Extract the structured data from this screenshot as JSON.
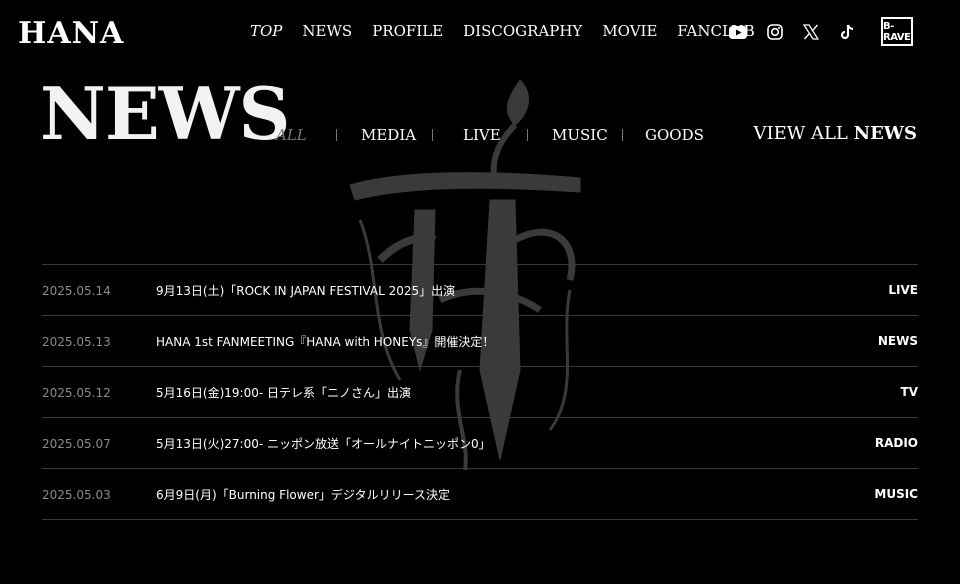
{
  "header": {
    "logo": "HANA",
    "nav": [
      {
        "label": "TOP",
        "active": true
      },
      {
        "label": "NEWS"
      },
      {
        "label": "PROFILE"
      },
      {
        "label": "DISCOGRAPHY"
      },
      {
        "label": "MOVIE"
      },
      {
        "label": "FANCLUB"
      }
    ],
    "social": [
      "youtube-icon",
      "instagram-icon",
      "x-icon",
      "tiktok-icon"
    ],
    "brand_badge": "B-RAVE"
  },
  "section": {
    "title": "NEWS",
    "categories": [
      {
        "label": "ALL",
        "active": true
      },
      {
        "label": "MEDIA"
      },
      {
        "label": "LIVE"
      },
      {
        "label": "MUSIC"
      },
      {
        "label": "GOODS"
      }
    ],
    "view_all_prefix": "VIEW ALL",
    "view_all_suffix": "NEWS"
  },
  "news": [
    {
      "date": "2025.05.14",
      "title": "9月13日(土)「ROCK IN JAPAN FESTIVAL 2025」出演",
      "category": "LIVE"
    },
    {
      "date": "2025.05.13",
      "title": "HANA 1st FANMEETING『HANA with HONEYs』開催決定！",
      "category": "NEWS"
    },
    {
      "date": "2025.05.12",
      "title": "5月16日(金)19:00- 日テレ系「ニノさん」出演",
      "category": "TV"
    },
    {
      "date": "2025.05.07",
      "title": "5月13日(火)27:00- ニッポン放送「オールナイトニッポン0」",
      "category": "RADIO"
    },
    {
      "date": "2025.05.03",
      "title": "6月9日(月)「Burning Flower」デジタルリリース決定",
      "category": "MUSIC"
    }
  ],
  "colors": {
    "background": "#000000",
    "text": "#ffffff",
    "muted": "#8a8a8a",
    "divider": "#3a3a3a",
    "watermark": "#3a3a3a"
  }
}
